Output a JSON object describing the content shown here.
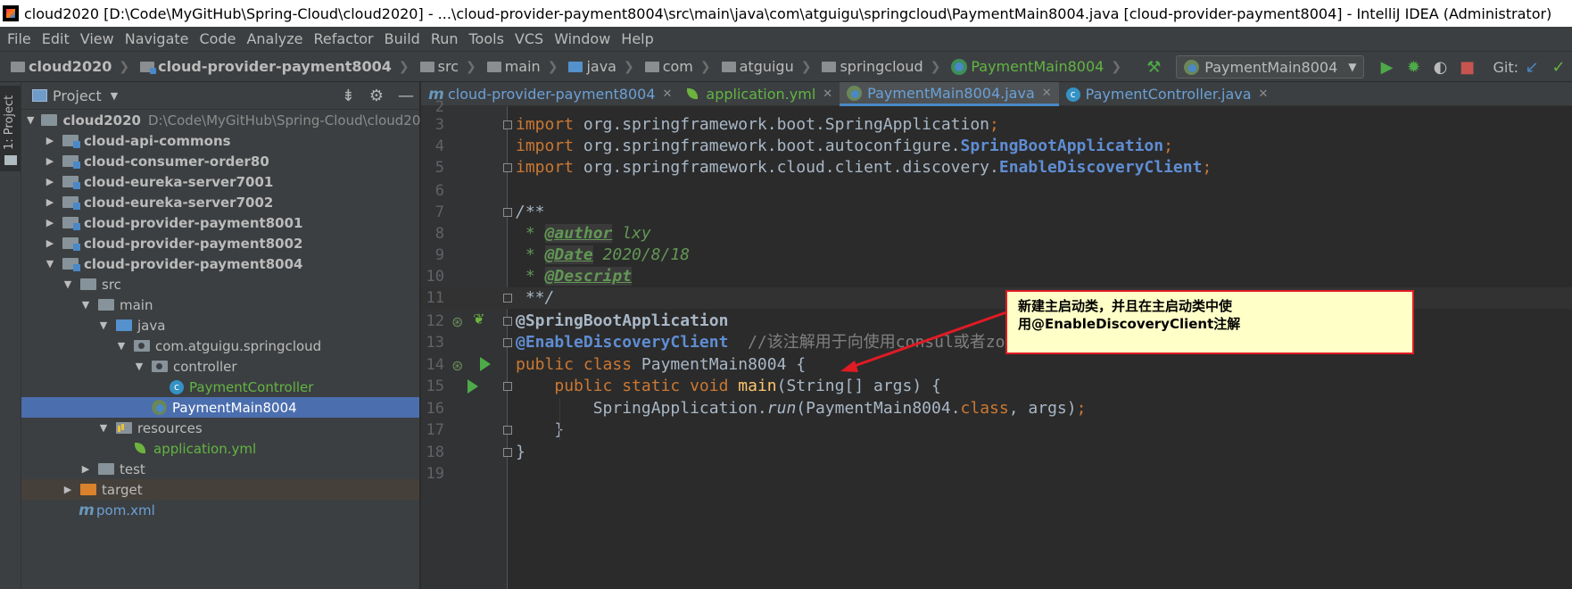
{
  "window": {
    "title": "cloud2020 [D:\\Code\\MyGitHub\\Spring-Cloud\\cloud2020] - ...\\cloud-provider-payment8004\\src\\main\\java\\com\\atguigu\\springcloud\\PaymentMain8004.java [cloud-provider-payment8004] - IntelliJ IDEA (Administrator)"
  },
  "menu": [
    "File",
    "Edit",
    "View",
    "Navigate",
    "Code",
    "Analyze",
    "Refactor",
    "Build",
    "Run",
    "Tools",
    "VCS",
    "Window",
    "Help"
  ],
  "breadcrumbs": [
    "cloud2020",
    "cloud-provider-payment8004",
    "src",
    "main",
    "java",
    "com",
    "atguigu",
    "springcloud",
    "PaymentMain8004"
  ],
  "toolbar": {
    "run_config": "PaymentMain8004",
    "git_label": "Git:"
  },
  "tool_strip": {
    "project_tab": "1: Project"
  },
  "project": {
    "header": "Project",
    "root_name": "cloud2020",
    "root_path": "D:\\Code\\MyGitHub\\Spring-Cloud\\cloud2020",
    "tree": [
      {
        "label": "cloud-api-commons"
      },
      {
        "label": "cloud-consumer-order80"
      },
      {
        "label": "cloud-eureka-server7001"
      },
      {
        "label": "cloud-eureka-server7002"
      },
      {
        "label": "cloud-provider-payment8001"
      },
      {
        "label": "cloud-provider-payment8002"
      },
      {
        "label": "cloud-provider-payment8004"
      },
      {
        "label": "src"
      },
      {
        "label": "main"
      },
      {
        "label": "java"
      },
      {
        "label": "com.atguigu.springcloud"
      },
      {
        "label": "controller"
      },
      {
        "label": "PaymentController"
      },
      {
        "label": "PaymentMain8004"
      },
      {
        "label": "resources"
      },
      {
        "label": "application.yml"
      },
      {
        "label": "test"
      },
      {
        "label": "target"
      },
      {
        "label": "pom.xml"
      }
    ]
  },
  "tabs": [
    {
      "label": "cloud-provider-payment8004"
    },
    {
      "label": "application.yml"
    },
    {
      "label": "PaymentMain8004.java"
    },
    {
      "label": "PaymentController.java"
    }
  ],
  "editor": {
    "lines": [
      {
        "n": "2"
      },
      {
        "n": "3",
        "a": "import ",
        "b": "org.springframework.boot.SpringApplication",
        "c": ";"
      },
      {
        "n": "4",
        "a": "import ",
        "b": "org.springframework.boot.autoconfigure.",
        "d": "SpringBootApplication",
        "c": ";"
      },
      {
        "n": "5",
        "a": "import ",
        "b": "org.springframework.cloud.client.discovery.",
        "d": "EnableDiscoveryClient",
        "c": ";"
      },
      {
        "n": "6"
      },
      {
        "n": "7",
        "cm": "/**"
      },
      {
        "n": "8",
        "cm": " * ",
        "tag": "@author",
        "rest": " lxy"
      },
      {
        "n": "9",
        "cm": " * ",
        "tag": "@Date",
        "rest": " 2020/8/18"
      },
      {
        "n": "10",
        "cm": " * ",
        "tag": "@Descript"
      },
      {
        "n": "11",
        "cm": " **/"
      },
      {
        "n": "12",
        "ann": "@SpringBootApplication"
      },
      {
        "n": "13",
        "ann": "@EnableDiscoveryClient",
        "comment": "  //该注解用于向使用consul或者zookeeper作为注册中心是注册服务"
      },
      {
        "n": "14",
        "kw1": "public class ",
        "name": "PaymentMain8004 {"
      },
      {
        "n": "15",
        "ind": "    ",
        "kw1": "public static void ",
        "meth": "main",
        "args": "(String[] args) {"
      },
      {
        "n": "16",
        "ind": "        ",
        "cls": "SpringApplication.",
        "call": "run",
        "p1": "(PaymentMain8004.",
        "kw2": "class",
        "p2": ", args)",
        "semi": ";"
      },
      {
        "n": "17",
        "ind": "    ",
        "plain": "}"
      },
      {
        "n": "18",
        "plain": "}"
      },
      {
        "n": "19"
      }
    ]
  },
  "callout": {
    "line1": "新建主启动类，并且在主启动类中使",
    "line2": "用@EnableDiscoveryClient注解"
  },
  "colors": {
    "accent": "#4a88c7",
    "selection": "#4b6eaf",
    "callout_border": "#e01b24",
    "callout_bg": "#ffffc8"
  }
}
